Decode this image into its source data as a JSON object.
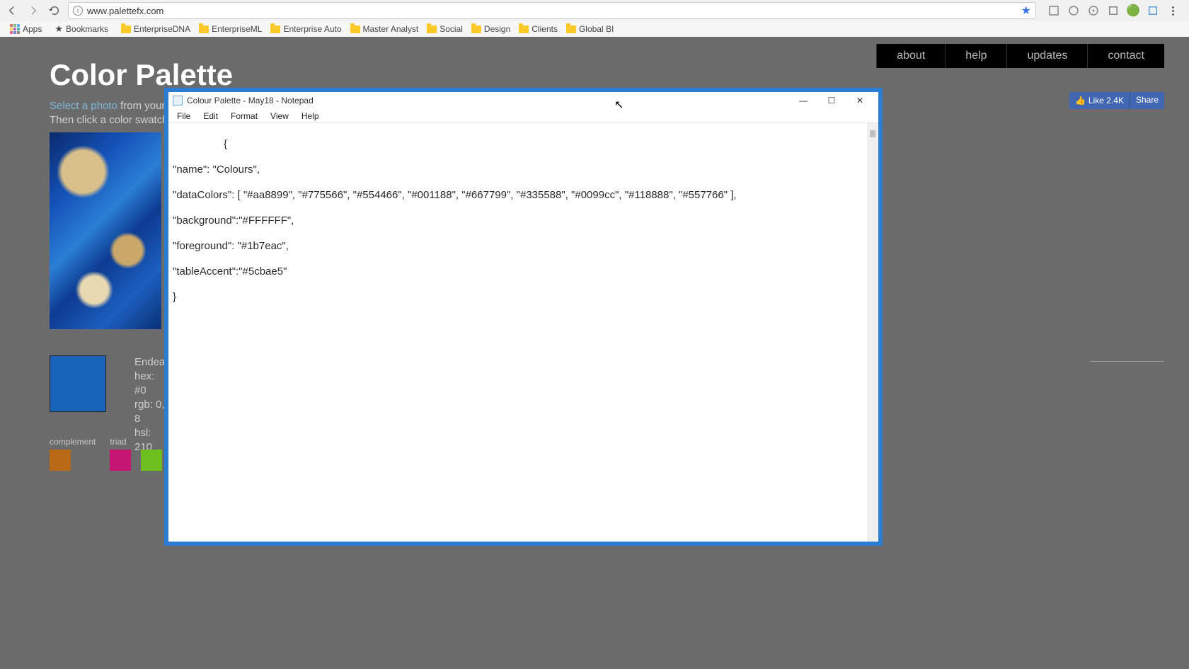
{
  "browser": {
    "url": "www.palettefx.com",
    "apps_label": "Apps",
    "bookmarks_label": "Bookmarks",
    "folders": [
      "EnterpriseDNA",
      "EnterpriseML",
      "Enterprise Auto",
      "Master Analyst",
      "Social",
      "Design",
      "Clients",
      "Global BI"
    ]
  },
  "site": {
    "title": "Color Palette",
    "sub_hl": "Select a photo",
    "sub_rest1": " from your de",
    "sub_line2": "Then click a color swatch to",
    "nav": [
      "about",
      "help",
      "updates",
      "contact"
    ],
    "fb_like": "Like 2.4K",
    "fb_share": "Share"
  },
  "swatch": {
    "name_partial": "Endea",
    "hex_partial": "hex: #0",
    "rgb_partial": "rgb: 0, 8",
    "hsl_partial": "hsl: 210",
    "complement_label": "complement",
    "triad_label": "triad",
    "colors": {
      "big": "#1764b8",
      "complement": "#b86a17",
      "triad1": "#c71774",
      "triad2": "#6cbf1e"
    }
  },
  "notepad": {
    "title": "Colour Palette - May18 - Notepad",
    "menus": [
      "File",
      "Edit",
      "Format",
      "View",
      "Help"
    ],
    "content": "{\n\n\"name\": \"Colours\",\n\n\"dataColors\": [ \"#aa8899\", \"#775566\", \"#554466\", \"#001188\", \"#667799\", \"#335588\", \"#0099cc\", \"#118888\", \"#557766\" ],\n\n\"background\":\"#FFFFFF\",\n\n\"foreground\": \"#1b7eac\",\n\n\"tableAccent\":\"#5cbae5\"\n\n}"
  }
}
